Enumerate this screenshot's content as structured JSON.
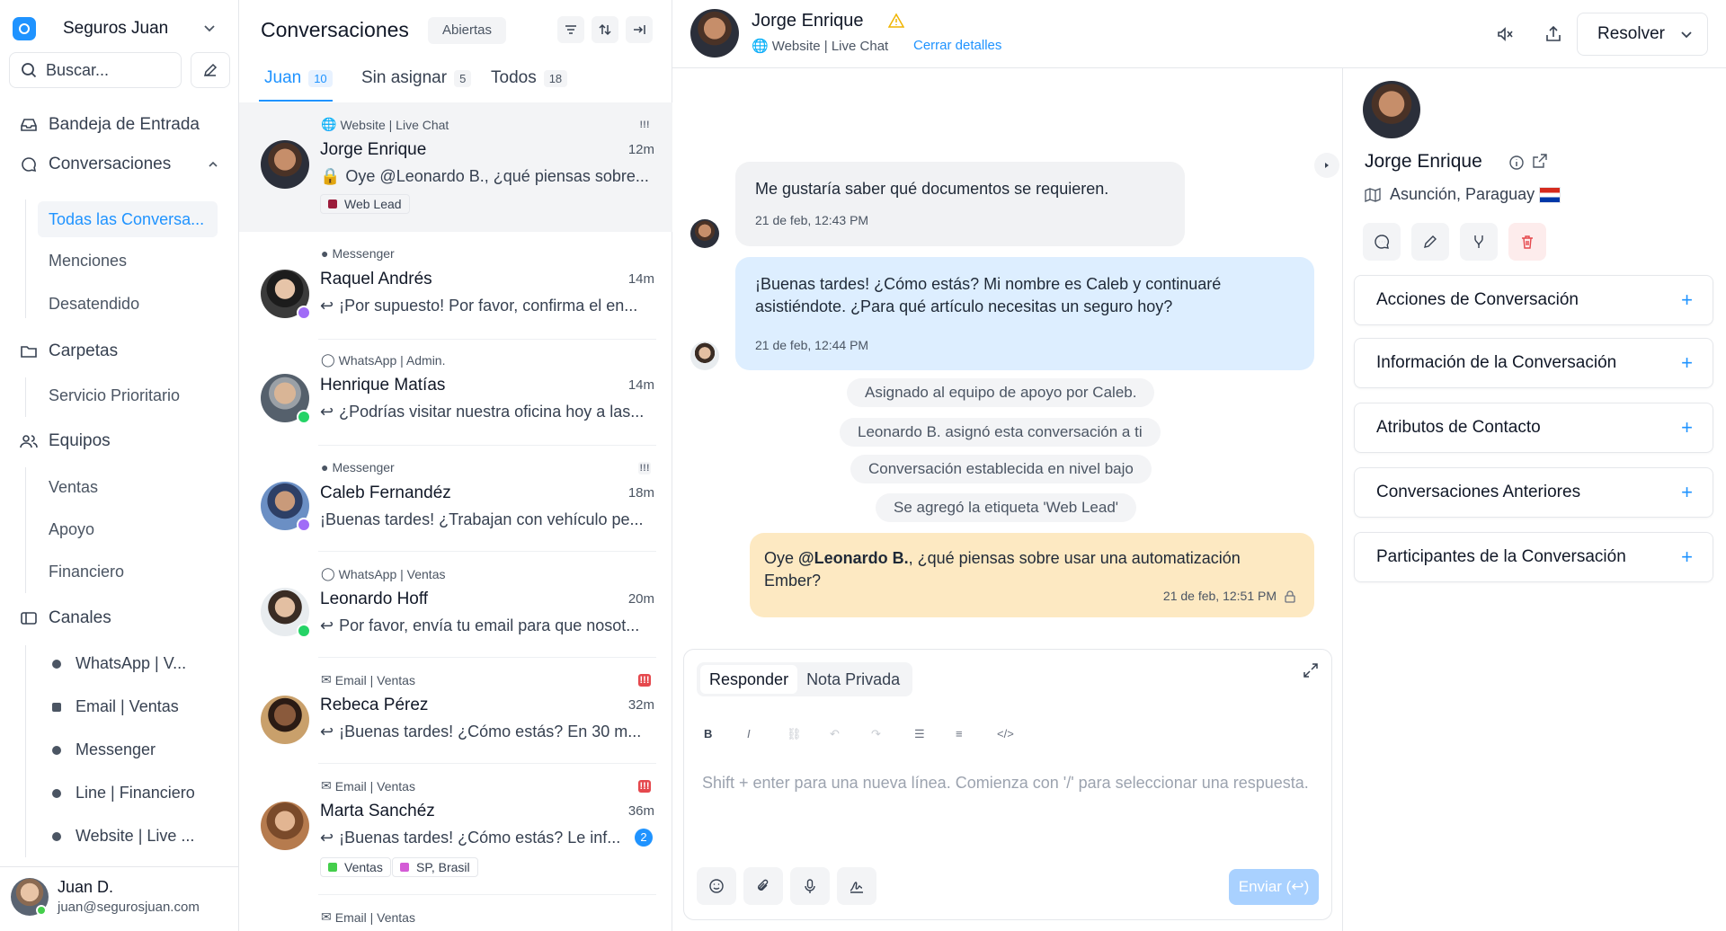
{
  "sidebar": {
    "account_name": "Seguros Juan",
    "search_label": "Buscar...",
    "inbox": "Bandeja de Entrada",
    "conversations": "Conversaciones",
    "conv_items": [
      "Todas las Conversa...",
      "Menciones",
      "Desatendido"
    ],
    "folders": "Carpetas",
    "folder_items": [
      "Servicio Prioritario"
    ],
    "teams": "Equipos",
    "team_items": [
      "Ventas",
      "Apoyo",
      "Financiero"
    ],
    "channels": "Canales",
    "channel_items": [
      "WhatsApp | V...",
      "Email | Ventas",
      "Messenger",
      "Line | Financiero",
      "Website | Live ..."
    ],
    "user": {
      "name": "Juan D.",
      "email": "juan@segurosjuan.com"
    }
  },
  "list": {
    "title": "Conversaciones",
    "status": "Abiertas",
    "tabs": [
      {
        "label": "Juan",
        "count": "10"
      },
      {
        "label": "Sin asignar",
        "count": "5"
      },
      {
        "label": "Todos",
        "count": "18"
      }
    ],
    "cards": [
      {
        "inbox": "Website | Live Chat",
        "name": "Jorge Enrique",
        "time": "12m",
        "msg": "Oye @Leonardo B., ¿qué piensas sobre...",
        "labels": [
          "Web Lead"
        ]
      },
      {
        "inbox": "Messenger",
        "name": "Raquel Andrés",
        "time": "14m",
        "msg": "¡Por supuesto! Por favor, confirma el en..."
      },
      {
        "inbox": "WhatsApp | Admin.",
        "name": "Henrique Matías",
        "time": "14m",
        "msg": "¿Podrías visitar nuestra oficina hoy a las..."
      },
      {
        "inbox": "Messenger",
        "name": "Caleb Fernandéz",
        "time": "18m",
        "msg": "¡Buenas tardes! ¿Trabajan con vehículo pe..."
      },
      {
        "inbox": "WhatsApp | Ventas",
        "name": "Leonardo Hoff",
        "time": "20m",
        "msg": "Por favor, envía tu email para que nosot..."
      },
      {
        "inbox": "Email | Ventas",
        "name": "Rebeca Pérez",
        "time": "32m",
        "msg": "¡Buenas tardes! ¿Cómo estás? En 30 m..."
      },
      {
        "inbox": "Email | Ventas",
        "name": "Marta Sanchéz",
        "time": "36m",
        "msg": "¡Buenas tardes! ¿Cómo estás? Le inf...",
        "unread": "2",
        "labels": [
          "Ventas",
          "SP, Brasil"
        ]
      },
      {
        "inbox": "Email | Ventas"
      }
    ]
  },
  "chat": {
    "contact": "Jorge Enrique",
    "channel": "Website | Live Chat",
    "close_details": "Cerrar detalles",
    "resolve": "Resolver",
    "messages": [
      {
        "text": "Me gustaría saber qué documentos se requieren.",
        "time": "21 de feb, 12:43 PM"
      },
      {
        "text": "¡Buenas tardes! ¿Cómo estás? Mi nombre es Caleb y continuaré asistiéndote. ¿Para qué artículo necesitas un seguro hoy?",
        "time": "21 de feb, 12:44 PM"
      }
    ],
    "activities": [
      "Asignado al equipo de apoyo por Caleb.",
      "Leonardo B. asignó esta conversación a ti",
      "Conversación establecida en nivel bajo",
      "Se agregó la etiqueta 'Web Lead'"
    ],
    "private_note": {
      "prefix": "Oye ",
      "mention": "@Leonardo B.",
      "rest": ", ¿qué piensas sobre usar una automatización Ember?",
      "time": "21 de feb, 12:51 PM"
    },
    "composer": {
      "reply": "Responder",
      "private": "Nota Privada",
      "placeholder": "Shift + enter para una nueva línea. Comienza con '/' para seleccionar una respuesta.",
      "send": "Enviar (↩)"
    }
  },
  "panel": {
    "name": "Jorge Enrique",
    "location": "Asunción, Paraguay",
    "sections": [
      "Acciones de Conversación",
      "Información de la Conversación",
      "Atributos de Contacto",
      "Conversaciones Anteriores",
      "Participantes de la Conversación"
    ]
  },
  "colors": {
    "accent": "#1f93ff",
    "private_note": "#fde9c2",
    "bot_bubble": "#ddeeff",
    "web_lead": "#9b1c3b",
    "ventas": "#44ce4b",
    "sp_brasil": "#d45bd6",
    "priority_urgent": "#e5484d"
  }
}
